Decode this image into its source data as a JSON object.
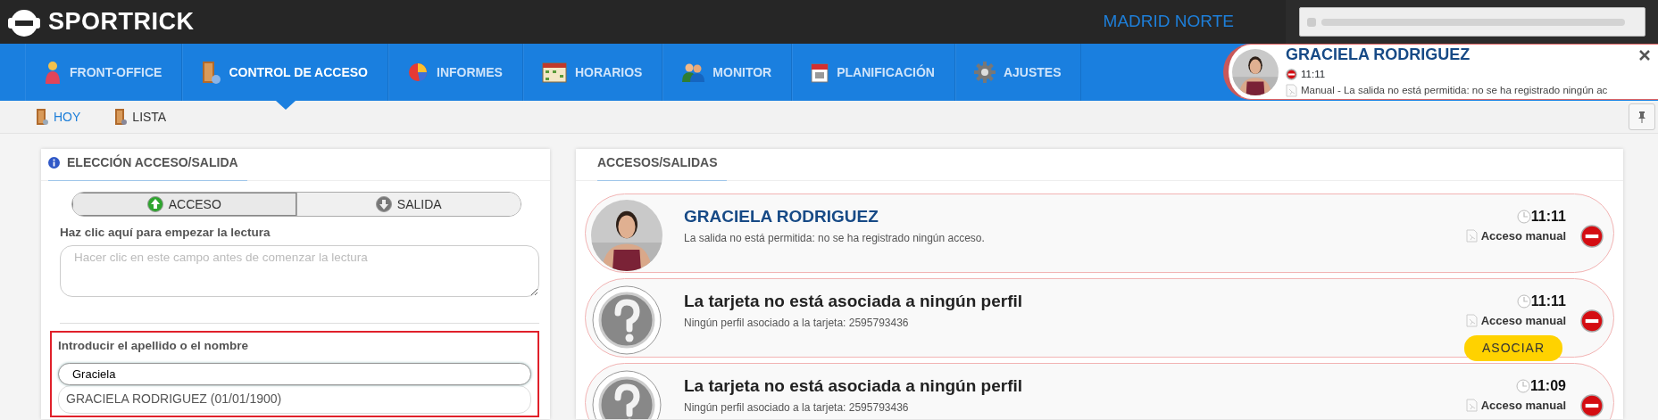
{
  "header": {
    "logo": "SPORTRICK",
    "site": "MADRID NORTE"
  },
  "nav": [
    {
      "label": "FRONT-OFFICE",
      "selected": false
    },
    {
      "label": "CONTROL DE ACCESO",
      "selected": true
    },
    {
      "label": "INFORMES",
      "selected": false
    },
    {
      "label": "HORARIOS",
      "selected": false
    },
    {
      "label": "MONITOR",
      "selected": false
    },
    {
      "label": "PLANIFICACIÓN",
      "selected": false
    },
    {
      "label": "AJUSTES",
      "selected": false
    }
  ],
  "notification": {
    "name": "GRACIELA RODRIGUEZ",
    "time": "11:11",
    "message": "Manual - La salida no está permitida: no se ha registrado ningún ac"
  },
  "subnav": [
    {
      "label": "HOY",
      "selected": true
    },
    {
      "label": "LISTA",
      "selected": false
    }
  ],
  "left_panel": {
    "title": "ELECCIÓN ACCESO/SALIDA",
    "toggle": [
      {
        "label": "ACCESO",
        "kind": "up",
        "selected": true
      },
      {
        "label": "SALIDA",
        "kind": "down",
        "selected": false
      }
    ],
    "reading_label": "Haz clic aquí para empezar la lectura",
    "reading_placeholder": "Hacer clic en este campo antes de comenzar la lectura",
    "search_label": "Introducir el apellido o el nombre",
    "search_value": "Graciela",
    "suggestion": "GRACIELA RODRIGUEZ (01/01/1900)"
  },
  "right_panel": {
    "title": "ACCESOS/SALIDAS",
    "entries": [
      {
        "kind": "person",
        "title": "GRACIELA RODRIGUEZ",
        "detail": "La salida no está permitida: no se ha registrado ningún acceso.",
        "time": "11:11",
        "mode": "Acceso manual"
      },
      {
        "kind": "unknown",
        "title": "La tarjeta no está asociada a ningún perfil",
        "detail": "Ningún perfil asociado a la tarjeta: 2595793436",
        "time": "11:11",
        "mode": "Acceso manual",
        "action": "ASOCIAR"
      },
      {
        "kind": "unknown",
        "title": "La tarjeta no está asociada a ningún perfil",
        "detail": "Ningún perfil asociado a la tarjeta: 2595793436",
        "time": "11:09",
        "mode": "Acceso manual"
      }
    ]
  }
}
